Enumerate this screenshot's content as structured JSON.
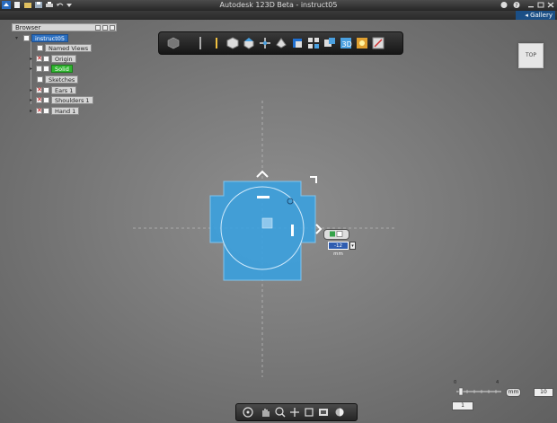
{
  "window": {
    "title": "Autodesk 123D Beta - instruct05"
  },
  "gallery": {
    "label": "Gallery"
  },
  "browser": {
    "title": "Browser",
    "items": [
      {
        "label": "instruct05",
        "kind": "root"
      },
      {
        "label": "Named Views",
        "kind": "folder"
      },
      {
        "label": "Origin",
        "kind": "hidden"
      },
      {
        "label": "Solid",
        "kind": "visible"
      },
      {
        "label": "Sketches",
        "kind": "folder"
      },
      {
        "label": "Ears 1",
        "kind": "hidden"
      },
      {
        "label": "Shoulders 1",
        "kind": "hidden"
      },
      {
        "label": "Hand 1",
        "kind": "hidden"
      }
    ]
  },
  "toolbar": {
    "icons": [
      "home-view-icon",
      "divider-icon",
      "sketch-pencil-icon",
      "box-primitive-icon",
      "extrude-icon",
      "move-icon",
      "revolve-icon",
      "shell-icon",
      "pattern-icon",
      "combine-icon",
      "text-3d-icon",
      "material-icon",
      "measure-icon"
    ]
  },
  "viewcube": {
    "label": "TOP"
  },
  "dimension": {
    "value": "-12 mm"
  },
  "grid": {
    "scale_min": "0",
    "scale_max": "4",
    "units": "mm",
    "snap_value": "10",
    "grid_value": "1"
  },
  "colors": {
    "accent": "#2f9ee0",
    "selection": "#3ca0dc",
    "titlebar": "#2e2e2e"
  }
}
